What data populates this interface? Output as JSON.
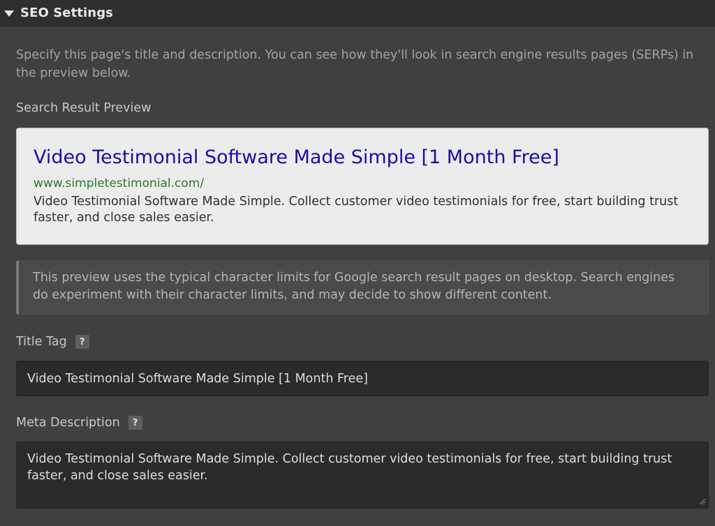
{
  "header": {
    "title": "SEO Settings"
  },
  "intro_text": "Specify this page's title and description. You can see how they'll look in search engine results pages (SERPs) in the preview below.",
  "preview": {
    "label": "Search Result Preview",
    "title": "Video Testimonial Software Made Simple [1 Month Free]",
    "url": "www.simpletestimonial.com/",
    "description": "Video Testimonial Software Made Simple. Collect customer video testimonials for free, start building trust faster, and close sales easier."
  },
  "note_text": "This preview uses the typical character limits for Google search result pages on desktop. Search engines do experiment with their character limits, and may decide to show different content.",
  "title_tag": {
    "label": "Title Tag",
    "help": "?",
    "value": "Video Testimonial Software Made Simple [1 Month Free]"
  },
  "meta_description": {
    "label": "Meta Description",
    "help": "?",
    "value": "Video Testimonial Software Made Simple. Collect customer video testimonials for free, start building trust faster, and close sales easier."
  },
  "colors": {
    "panel_bg": "#404040",
    "header_bg": "#2f2f2f",
    "serp_title": "#1a0dab",
    "serp_url": "#2a7a2a",
    "input_bg": "#2b2b2b"
  }
}
